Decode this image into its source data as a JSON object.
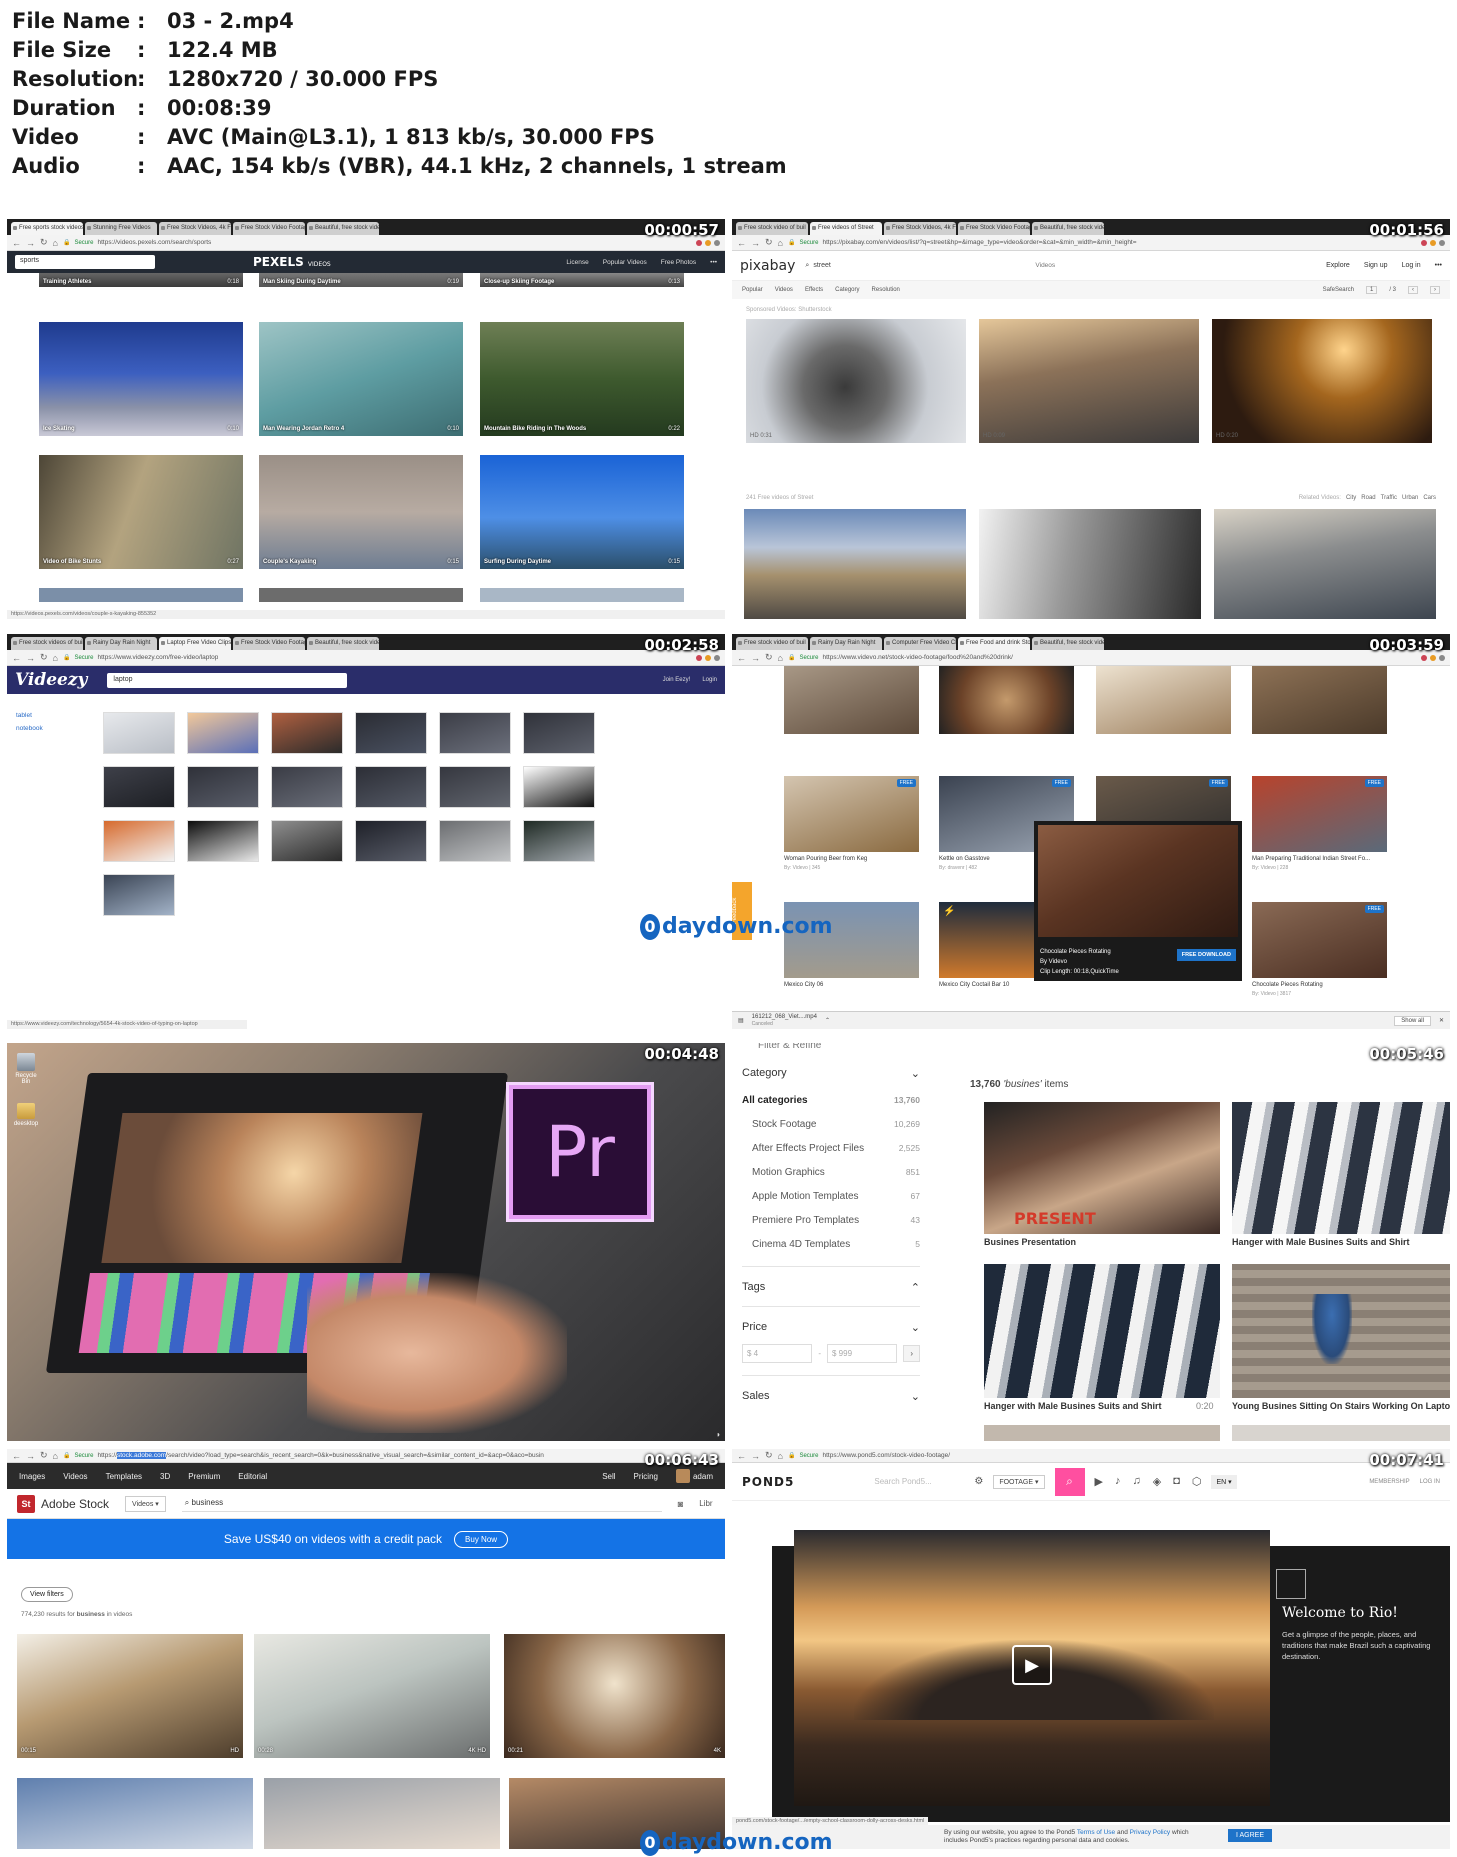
{
  "file_info": [
    {
      "key": "File Name",
      "value": "03 - 2.mp4"
    },
    {
      "key": "File Size",
      "value": "122.4 MB"
    },
    {
      "key": "Resolution",
      "value": "1280x720 / 30.000 FPS"
    },
    {
      "key": "Duration",
      "value": "00:08:39"
    },
    {
      "key": "Video",
      "value": "AVC (Main@L3.1), 1 813 kb/s, 30.000 FPS"
    },
    {
      "key": "Audio",
      "value": "AAC, 154 kb/s (VBR), 44.1 kHz, 2 channels, 1 stream"
    }
  ],
  "separator": ":",
  "watermark": "daydown.com",
  "frames": {
    "f1": {
      "timestamp": "00:00:57",
      "tabs": [
        "Free sports stock videos",
        "Stunning Free Videos",
        "Free Stock Videos, 4k Fo",
        "Free Stock Video Footag",
        "Beautiful, free stock vide"
      ],
      "secure": "Secure",
      "url": "https://videos.pexels.com/search/sports",
      "search": "sports",
      "logo": "PEXELS",
      "logo_sub": "VIDEOS",
      "nav": [
        "License",
        "Popular Videos",
        "Free Photos",
        "•••"
      ],
      "top_row": [
        {
          "title": "Training Athletes",
          "dur": "0:18"
        },
        {
          "title": "Man Skiing During Daytime",
          "dur": "0:19"
        },
        {
          "title": "Close-up Skiing Footage",
          "dur": "0:13"
        }
      ],
      "cards": [
        {
          "title": "Ice Skating",
          "dur": "0:10"
        },
        {
          "title": "Man Wearing Jordan Retro 4",
          "dur": "0:10"
        },
        {
          "title": "Mountain Bike Riding in The Woods",
          "dur": "0:22"
        },
        {
          "title": "Video of Bike Stunts",
          "dur": "0:27"
        },
        {
          "title": "Couple's Kayaking",
          "dur": "0:15"
        },
        {
          "title": "Surfing During Daytime",
          "dur": "0:15"
        }
      ],
      "status": "https://videos.pexels.com/videos/couple-s-kayaking-855352"
    },
    "f2": {
      "timestamp": "00:01:56",
      "tabs": [
        "Free stock video of buil",
        "Free videos of Street",
        "Free Stock Videos, 4k Fo",
        "Free Stock Video Footag",
        "Beautiful, free stock vide"
      ],
      "secure": "Secure",
      "url": "https://pixabay.com/en/videos/list/?q=street&hp=&image_type=video&order=&cat=&min_width=&min_height=",
      "logo": "pixabay",
      "search": "street",
      "type": "Videos",
      "nav": [
        "Explore",
        "Sign up",
        "Log in",
        "•••"
      ],
      "filters": [
        "Popular",
        "Videos",
        "Effects",
        "Category",
        "Resolution"
      ],
      "safesearch": "SafeSearch",
      "page": "1",
      "pages": "/ 3",
      "sponsored": "Sponsored Videos: Shutterstock",
      "hd": [
        "HD 0:31",
        "HD 0:09",
        "HD 0:20"
      ],
      "count_label": "241 Free videos of Street",
      "related_label": "Related Videos:",
      "related": [
        "City",
        "Road",
        "Traffic",
        "Urban",
        "Cars"
      ]
    },
    "f3": {
      "timestamp": "00:02:58",
      "tabs": [
        "Free stock videos of buil",
        "Rainy Day Rain Night",
        "Laptop Free Video Clips",
        "Free Stock Video Footag",
        "Beautiful, free stock vide"
      ],
      "secure": "Secure",
      "url": "https://www.videezy.com/free-video/laptop",
      "logo": "Videezy",
      "search": "laptop",
      "nav": [
        "Join Eezy!",
        "Login"
      ],
      "side": [
        "tablet",
        "notebook"
      ],
      "status": "https://www.videezy.com/technology/5654-4k-stock-video-of-typing-on-laptop"
    },
    "f4": {
      "timestamp": "00:03:59",
      "tabs": [
        "Free stock video of buil",
        "Rainy Day Rain Night",
        "Computer Free Video Cli",
        "Free Food and drink Sto",
        "Beautiful, free stock vide"
      ],
      "secure": "Secure",
      "url": "https://www.videvo.net/stock-video-footage/food%20and%20drink/",
      "free": "FREE",
      "captions": [
        {
          "title": "Woman Pouring Beer from Keg",
          "meta": "By: Videvo | 345"
        },
        {
          "title": "Kettle on Gasstove",
          "meta": "By: dravenr | 482"
        },
        {
          "title": "Man Preparing Traditional Indian Street Fo...",
          "meta": "By: Videvo | 228"
        },
        {
          "title": "Mexico City 06",
          "meta": ""
        },
        {
          "title": "Mexico City Coctail Bar 10",
          "meta": ""
        },
        {
          "title": "Chocolate Pieces Rotating",
          "meta": "By: Videvo | 3817"
        }
      ],
      "popup": {
        "title": "Chocolate Pieces Rotating",
        "by": "By Videvo",
        "clip": "Clip Length: 00:18,QuickTime",
        "button": "FREE DOWNLOAD"
      },
      "feedback": "Feedback",
      "download": {
        "name": "161212_068_Viet....mp4",
        "state": "Canceled",
        "show_all": "Show all"
      }
    },
    "f5": {
      "timestamp": "00:04:48",
      "desktop": [
        {
          "label": "Recycle Bin"
        },
        {
          "label": "deesktop"
        }
      ],
      "pr": "Pr"
    },
    "f6": {
      "timestamp": "00:05:46",
      "cut_header": "Filter & Refine",
      "category_title": "Category",
      "categories": [
        {
          "label": "All categories",
          "count": "13,760"
        },
        {
          "label": "Stock Footage",
          "count": "10,269"
        },
        {
          "label": "After Effects Project Files",
          "count": "2,525"
        },
        {
          "label": "Motion Graphics",
          "count": "851"
        },
        {
          "label": "Apple Motion Templates",
          "count": "67"
        },
        {
          "label": "Premiere Pro Templates",
          "count": "43"
        },
        {
          "label": "Cinema 4D Templates",
          "count": "5"
        }
      ],
      "tags": "Tags",
      "price": "Price",
      "price_min": "$ 4",
      "price_max": "$ 999",
      "dash": "-",
      "sales": "Sales",
      "count_num": "13,760",
      "count_query": "'busines'",
      "count_word": "items",
      "present": "PRESENT",
      "cards": [
        {
          "title": "Busines Presentation",
          "dur": ""
        },
        {
          "title": "Hanger with Male Busines Suits and Shirt",
          "dur": ""
        },
        {
          "title": "Hanger with Male Busines Suits and Shirt",
          "dur": "0:20"
        },
        {
          "title": "Young Busines Sitting On Stairs Working On Laptop",
          "dur": ""
        }
      ]
    },
    "f7": {
      "timestamp": "00:06:43",
      "secure": "Secure",
      "url_pre": "https://",
      "url_host": "stock.adobe.com",
      "url_rest": "/search/video?load_type=search&is_recent_search=0&k=business&native_visual_search=&similar_content_id=&acp=0&aco=busin",
      "menu": [
        "Images",
        "Videos",
        "Templates",
        "3D",
        "Premium",
        "Editorial"
      ],
      "right": [
        "Sell",
        "Pricing",
        "adam"
      ],
      "logo_short": "St",
      "title": "Adobe Stock",
      "type": "Videos",
      "search": "business",
      "libs": "Libr",
      "banner": "Save US$40 on videos with a credit pack",
      "banner_btn": "Buy Now",
      "filters_btn": "View filters",
      "results_count": "774,230",
      "results_mid": "results for",
      "results_term": "business",
      "results_post": "in videos",
      "durs": [
        "00:15",
        "00:28",
        "00:21"
      ],
      "badges": [
        "HD",
        "4K HD",
        "4K"
      ]
    },
    "f8": {
      "timestamp": "00:07:41",
      "secure": "Secure",
      "url": "https://www.pond5.com/stock-video-footage/",
      "logo": "POND5",
      "search": "Search Pond5...",
      "filter": "FOOTAGE",
      "lang": "EN",
      "links": [
        "MEMBERSHIP",
        "LOG IN"
      ],
      "welcome_title": "Welcome to Rio!",
      "welcome_body": "Get a glimpse of the people, places, and traditions that make Brazil such a captivating destination.",
      "cookie_a": "By using our website, you agree to the Pond5",
      "terms": "Terms of Use",
      "cookie_and": "and",
      "privacy": "Privacy Policy",
      "cookie_b": "which includes Pond5's practices regarding personal data and cookies.",
      "agree": "I AGREE",
      "status": "pond5.com/stock-footage/.../empty-school-classroom-dolly-across-desks.html"
    }
  }
}
